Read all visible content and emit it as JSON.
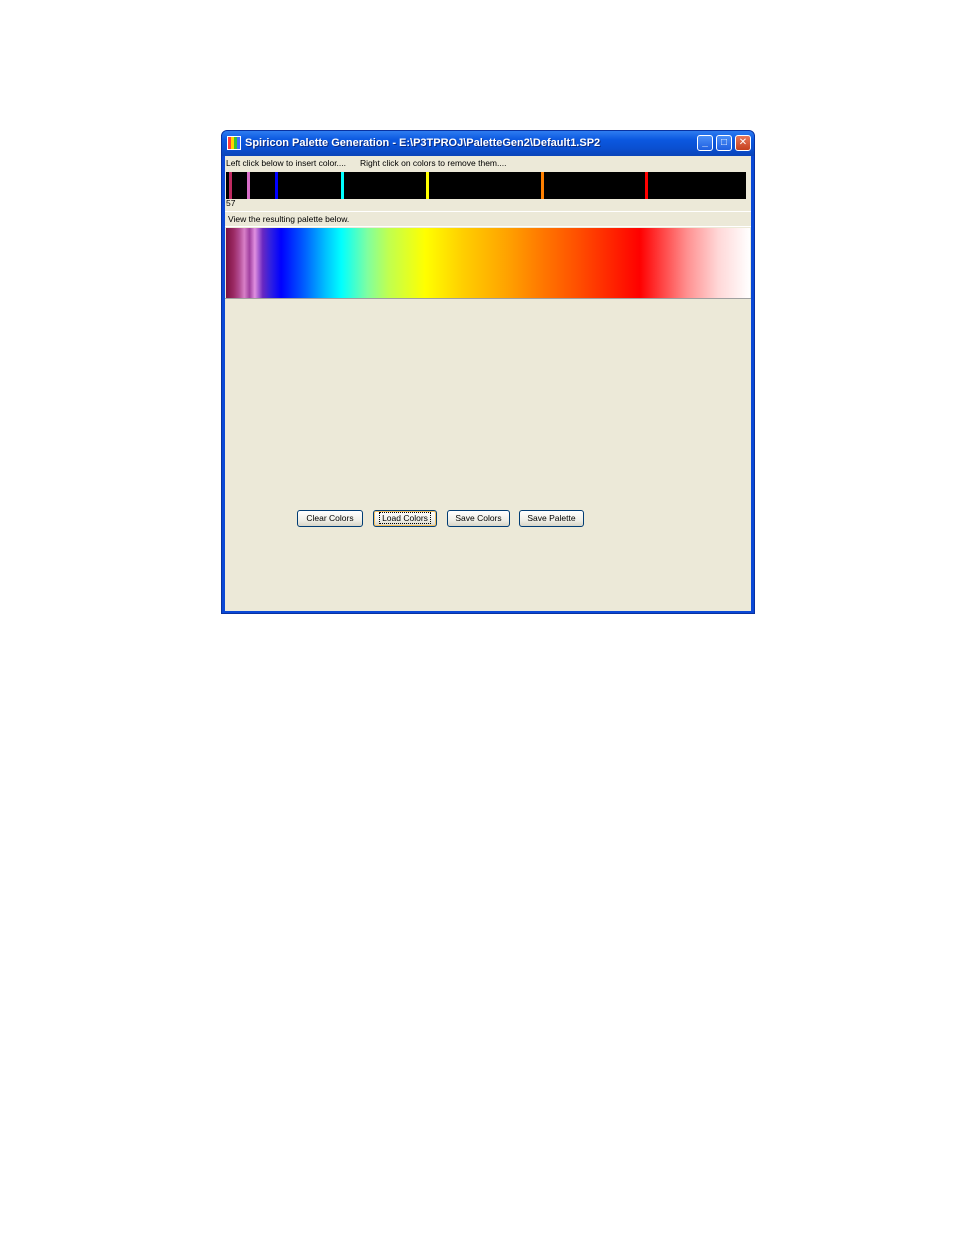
{
  "window": {
    "title": "Spiricon Palette Generation - E:\\P3TPROJ\\PaletteGen2\\Default1.SP2",
    "controls": {
      "minimize": "_",
      "maximize": "□",
      "close": "✕"
    }
  },
  "editor": {
    "insert_hint": "Left click below to insert color....",
    "remove_hint": "Right click on colors to remove them....",
    "background_color": "#000000",
    "markers": [
      {
        "color": "#c02a60",
        "position": 0.006
      },
      {
        "color": "#d86ec8",
        "position": 0.04
      },
      {
        "color": "#0000ff",
        "position": 0.095
      },
      {
        "color": "#00ffff",
        "position": 0.222
      },
      {
        "color": "#ffff00",
        "position": 0.385
      },
      {
        "color": "#ff8000",
        "position": 0.606
      },
      {
        "color": "#ff0000",
        "position": 0.806
      }
    ],
    "count": "57"
  },
  "palette": {
    "caption": "View the resulting palette below."
  },
  "buttons": {
    "clear": "Clear Colors",
    "load": "Load Colors",
    "save_colors": "Save Colors",
    "save_palette": "Save Palette"
  }
}
